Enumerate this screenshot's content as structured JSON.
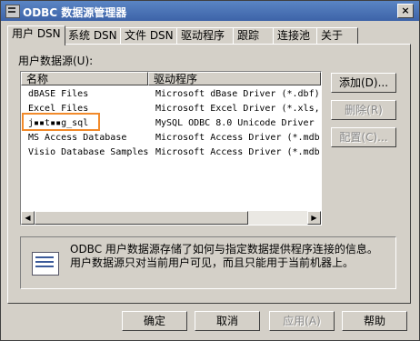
{
  "window": {
    "title": "ODBC 数据源管理器",
    "close_label": "×"
  },
  "tabs": [
    {
      "label": "用户 DSN"
    },
    {
      "label": "系统 DSN"
    },
    {
      "label": "文件 DSN"
    },
    {
      "label": "驱动程序"
    },
    {
      "label": "跟踪"
    },
    {
      "label": "连接池"
    },
    {
      "label": "关于"
    }
  ],
  "list": {
    "label": "用户数据源(U):",
    "columns": [
      "名称",
      "驱动程序"
    ],
    "rows": [
      {
        "name": "dBASE Files",
        "driver": "Microsoft dBase Driver (*.dbf)"
      },
      {
        "name": "Excel Files",
        "driver": "Microsoft Excel Driver (*.xls,"
      },
      {
        "name": "j▪▪t▪▪g_sql",
        "driver": "MySQL ODBC 8.0 Unicode Driver"
      },
      {
        "name": "MS Access Database",
        "driver": "Microsoft Access Driver (*.mdb"
      },
      {
        "name": "Visio Database Samples",
        "driver": "Microsoft Access Driver (*.mdb"
      }
    ],
    "scroll_left": "◀",
    "scroll_right": "▶"
  },
  "side_buttons": {
    "add": "添加(D)...",
    "remove": "删除(R)",
    "configure": "配置(C)..."
  },
  "info": {
    "text": "ODBC 用户数据源存储了如何与指定数据提供程序连接的信息。用户数据源只对当前用户可见，而且只能用于当前机器上。"
  },
  "footer": {
    "ok": "确定",
    "cancel": "取消",
    "apply": "应用(A)",
    "help": "帮助"
  },
  "colors": {
    "highlight": "#f28a2a",
    "titlebar": "#3d63a8"
  }
}
